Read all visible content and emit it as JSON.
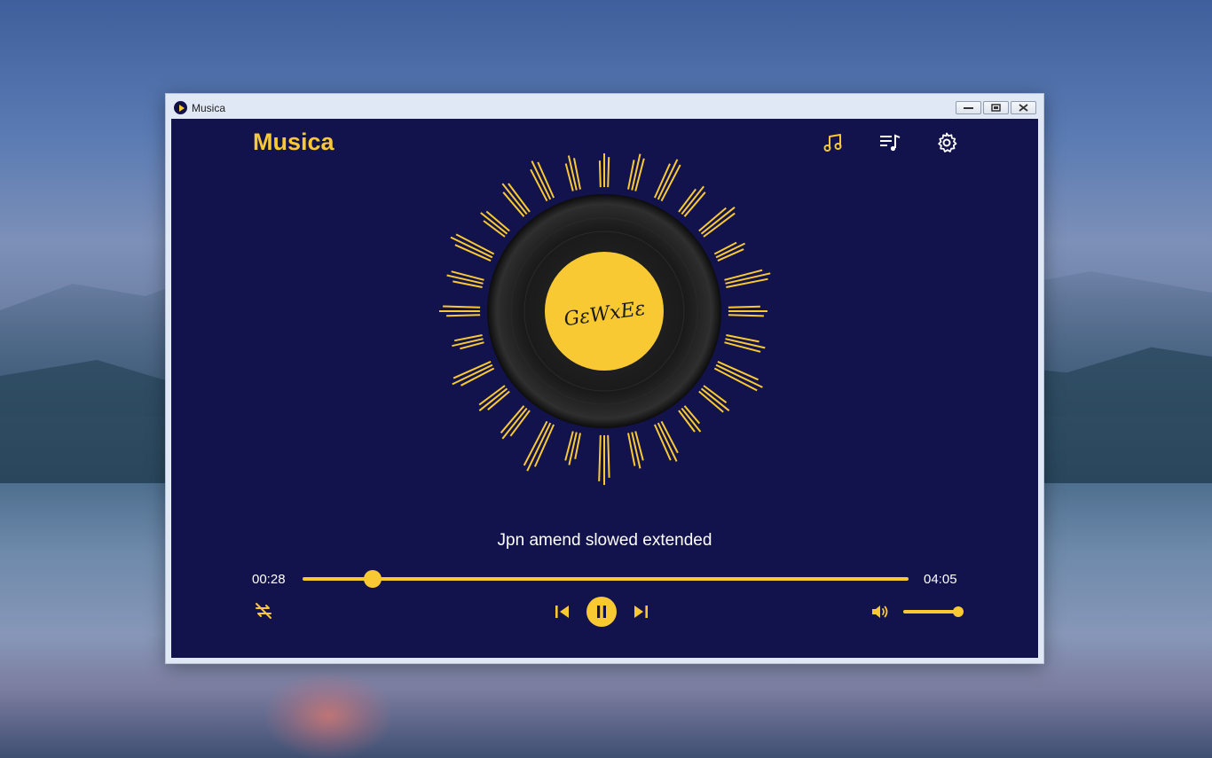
{
  "window": {
    "title": "Musica"
  },
  "app": {
    "brand": "Musica",
    "accent_color": "#f9c933",
    "background_color": "#12124c"
  },
  "header_icons": [
    "music-note-icon",
    "playlist-icon",
    "settings-icon"
  ],
  "disc": {
    "label_text": "GεWxEε"
  },
  "now_playing": {
    "title": "Jpn amend slowed extended",
    "current_time": "00:28",
    "total_time": "04:05",
    "progress": 0.115,
    "volume": 1.0
  },
  "controls": [
    "repeat-off-icon",
    "previous-icon",
    "pause-icon",
    "next-icon",
    "volume-icon"
  ]
}
